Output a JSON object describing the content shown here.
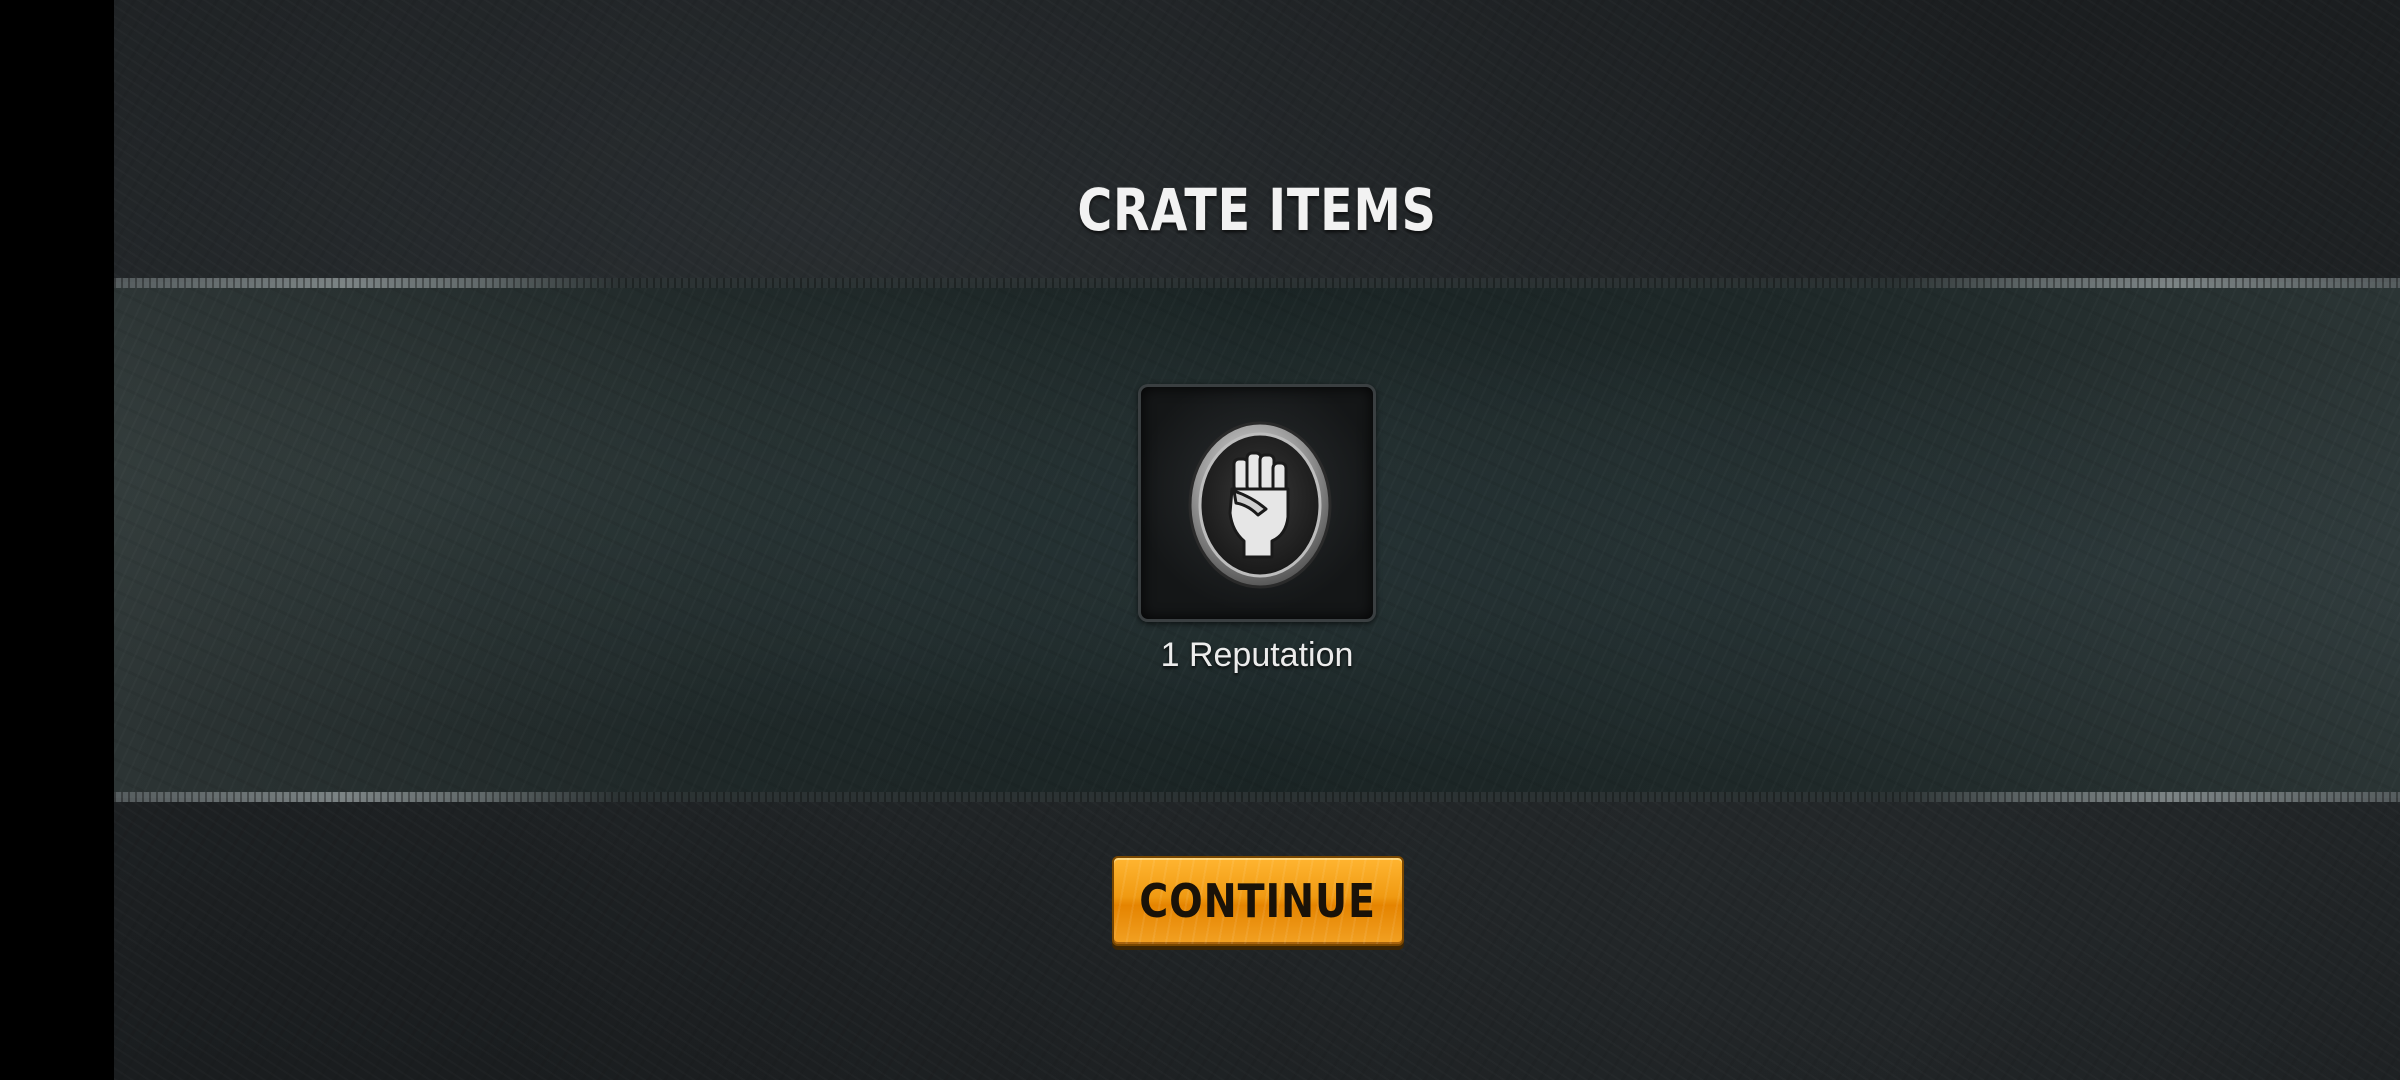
{
  "screen": {
    "title": "CRATE ITEMS"
  },
  "reward": {
    "icon": "raised-fist-icon",
    "label": "1 Reputation"
  },
  "actions": {
    "continue_label": "CONTINUE"
  },
  "colors": {
    "button_primary": "#f09a12",
    "title_text": "#f2f2f2",
    "background": "#1e2224"
  }
}
